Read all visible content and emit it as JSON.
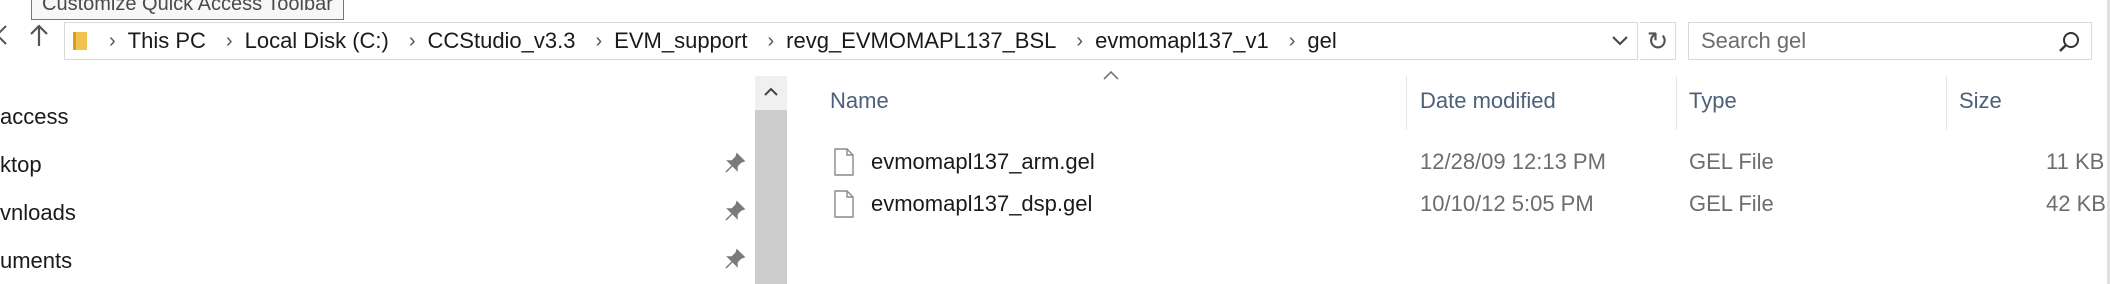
{
  "tooltip": {
    "text": "Customize Quick Access Toolbar"
  },
  "navigation": {
    "back_icon": "chevron-left-icon",
    "up_icon": "arrow-up-icon"
  },
  "address_bar": {
    "breadcrumbs": [
      {
        "label": "This PC"
      },
      {
        "label": "Local Disk (C:)"
      },
      {
        "label": "CCStudio_v3.3"
      },
      {
        "label": "EVM_support"
      },
      {
        "label": "revg_EVMOMAPL137_BSL"
      },
      {
        "label": "evmomapl137_v1"
      },
      {
        "label": "gel"
      }
    ],
    "separator": "›",
    "refresh_glyph": "↻"
  },
  "search": {
    "placeholder": "Search gel"
  },
  "nav_pane": {
    "items": [
      {
        "label": "access",
        "pinned": false
      },
      {
        "label": "ktop",
        "pinned": true
      },
      {
        "label": "vnloads",
        "pinned": true
      },
      {
        "label": "uments",
        "pinned": true
      }
    ]
  },
  "file_list": {
    "columns": [
      {
        "label": "Name"
      },
      {
        "label": "Date modified"
      },
      {
        "label": "Type"
      },
      {
        "label": "Size"
      }
    ],
    "rows": [
      {
        "name": "evmomapl137_arm.gel",
        "date": "12/28/09 12:13 PM",
        "type": "GEL File",
        "size": "11 KB"
      },
      {
        "name": "evmomapl137_dsp.gel",
        "date": "10/10/12 5:05 PM",
        "type": "GEL File",
        "size": "42 KB"
      }
    ]
  },
  "colors": {
    "column_header": "#4c607a",
    "folder_yellow": "#f2c14e",
    "scroll_thumb": "#cdcdcd"
  }
}
